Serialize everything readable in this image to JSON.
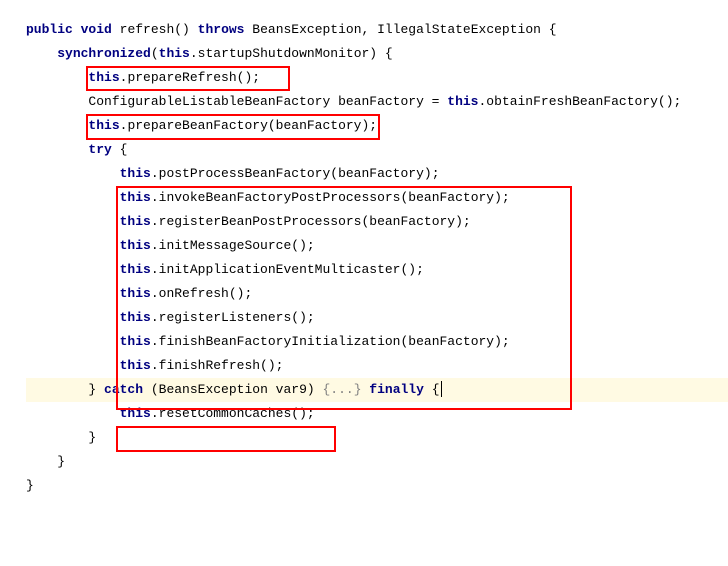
{
  "code": {
    "l1_kw1": "public",
    "l1_kw2": "void",
    "l1_t1": " refresh() ",
    "l1_kw3": "throws",
    "l1_t2": " BeansException, IllegalStateException {",
    "l2_kw1": "synchronized",
    "l2_t1": "(",
    "l2_kw2": "this",
    "l2_t2": ".startupShutdownMonitor) {",
    "l3_kw1": "this",
    "l3_t1": ".prepareRefresh();",
    "l4_t1": "ConfigurableListableBeanFactory beanFactory = ",
    "l4_kw1": "this",
    "l4_t2": ".obtainFreshBeanFactory();",
    "l5_kw1": "this",
    "l5_t1": ".prepareBeanFactory(beanFactory);",
    "l6_space": "",
    "l7_kw1": "try",
    "l7_t1": " {",
    "l8_kw1": "this",
    "l8_t1": ".postProcessBeanFactory(beanFactory);",
    "l9_kw1": "this",
    "l9_t1": ".invokeBeanFactoryPostProcessors(beanFactory);",
    "l10_kw1": "this",
    "l10_t1": ".registerBeanPostProcessors(beanFactory);",
    "l11_kw1": "this",
    "l11_t1": ".initMessageSource();",
    "l12_kw1": "this",
    "l12_t1": ".initApplicationEventMulticaster();",
    "l13_kw1": "this",
    "l13_t1": ".onRefresh();",
    "l14_kw1": "this",
    "l14_t1": ".registerListeners();",
    "l15_kw1": "this",
    "l15_t1": ".finishBeanFactoryInitialization(beanFactory);",
    "l16_kw1": "this",
    "l16_t1": ".finishRefresh();",
    "l17_t1": "} ",
    "l17_kw1": "catch",
    "l17_t2": " (BeansException var9) ",
    "l17_fold": "{...}",
    "l17_kw2": " finally",
    "l17_t3": " {",
    "l18_kw1": "this",
    "l18_t1": ".resetCommonCaches();",
    "l19_t1": "}",
    "l20_space": "",
    "l21_t1": "}",
    "l22_t1": "}"
  },
  "indent": {
    "i1": "    ",
    "i2": "        ",
    "i3": "            ",
    "i4": "                "
  }
}
